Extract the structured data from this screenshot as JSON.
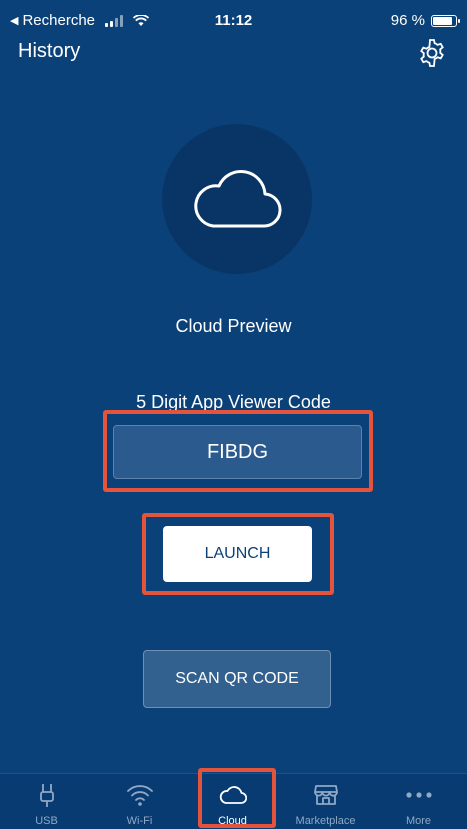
{
  "status_bar": {
    "back_label": "Recherche",
    "time": "11:12",
    "battery": "96 %",
    "battery_level": 0.96
  },
  "nav": {
    "title": "History",
    "settings_icon": "gear-icon"
  },
  "hero": {
    "icon": "cloud-icon",
    "caption": "Cloud Preview"
  },
  "code": {
    "label": "5 Digit App Viewer Code",
    "value": "FIBDG"
  },
  "buttons": {
    "launch": "LAUNCH",
    "scan": "SCAN QR CODE"
  },
  "tabs": [
    {
      "label": "USB",
      "icon": "usb-icon",
      "active": false
    },
    {
      "label": "Wi-Fi",
      "icon": "wifi-icon",
      "active": false
    },
    {
      "label": "Cloud",
      "icon": "cloud-icon",
      "active": true
    },
    {
      "label": "Marketplace",
      "icon": "store-icon",
      "active": false
    },
    {
      "label": "More",
      "icon": "more-icon",
      "active": false
    }
  ],
  "colors": {
    "background": "#0b4179",
    "highlight": "#e4533b",
    "tab_inactive": "#8fa9c6"
  }
}
